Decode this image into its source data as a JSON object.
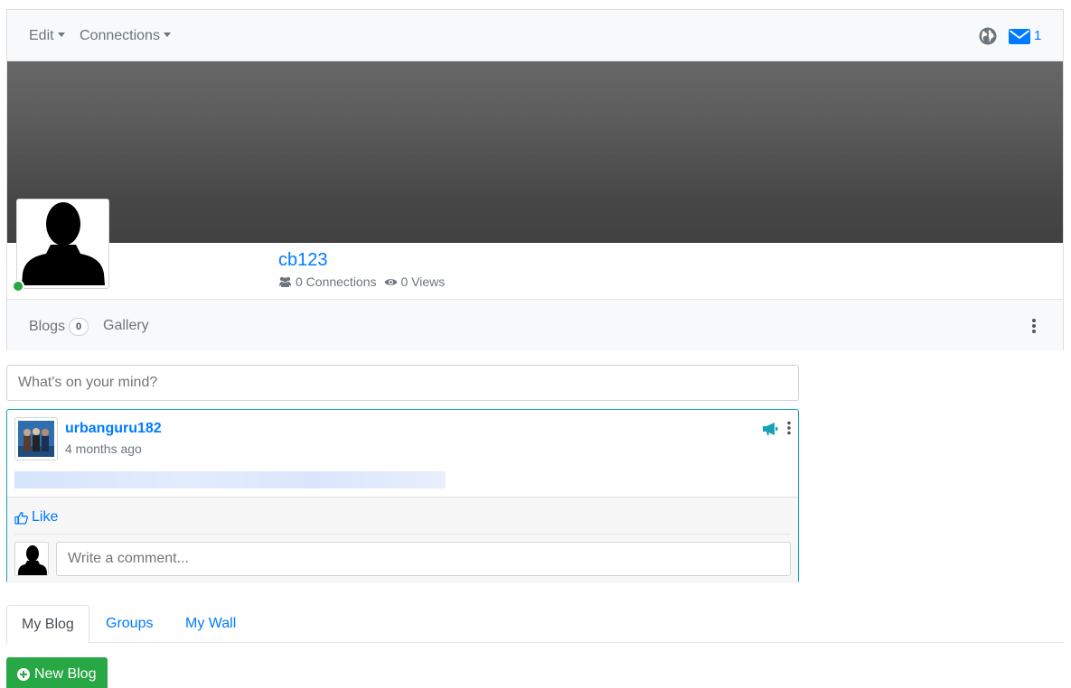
{
  "topbar": {
    "edit_label": "Edit",
    "connections_label": "Connections",
    "globe_icon": "globe-icon",
    "mail_icon": "envelope-icon",
    "mail_count": "1"
  },
  "profile": {
    "username": "cb123",
    "connections_text": "0 Connections",
    "views_text": "0 Views",
    "online_status_color": "#28a745"
  },
  "profile_tabs": {
    "blogs_label": "Blogs",
    "blogs_count": "0",
    "gallery_label": "Gallery"
  },
  "status_input": {
    "placeholder": "What's on your mind?"
  },
  "post": {
    "author": "urbanguru182",
    "time": "4 months ago",
    "like_label": "Like",
    "comment_placeholder": "Write a comment..."
  },
  "content_tabs": [
    {
      "label": "My Blog"
    },
    {
      "label": "Groups"
    },
    {
      "label": "My Wall"
    }
  ],
  "new_blog_label": "New Blog",
  "colors": {
    "primary": "#007bff",
    "success": "#28a745",
    "info": "#17a2b8",
    "muted": "#6c757d"
  }
}
